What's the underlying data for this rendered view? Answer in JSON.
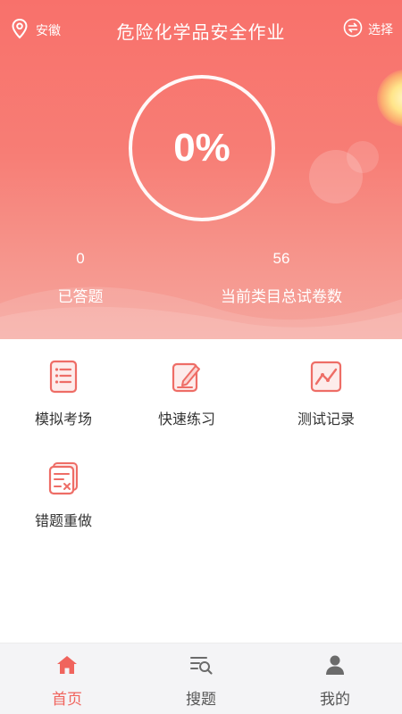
{
  "header": {
    "location": "安徽",
    "title": "危险化学品安全作业",
    "switch_label": "选择"
  },
  "progress": {
    "percent_text": "0%",
    "answered_count": "0",
    "answered_label": "已答题",
    "total_papers": "56",
    "total_papers_label": "当前类目总试卷数"
  },
  "actions": [
    {
      "label": "模拟考场",
      "icon": "exam-list-icon"
    },
    {
      "label": "快速练习",
      "icon": "edit-practice-icon"
    },
    {
      "label": "测试记录",
      "icon": "trend-chart-icon"
    },
    {
      "label": "错题重做",
      "icon": "wrong-question-icon"
    }
  ],
  "tabbar": {
    "items": [
      {
        "label": "首页",
        "icon": "home-icon",
        "active": true
      },
      {
        "label": "搜题",
        "icon": "search-list-icon",
        "active": false
      },
      {
        "label": "我的",
        "icon": "user-icon",
        "active": false
      }
    ]
  },
  "colors": {
    "accent": "#f0645d",
    "hero_top": "#f8716b",
    "hero_bottom": "#f5a59d",
    "icon": "#ee6d66",
    "text": "#333333",
    "tab_inactive": "#6b6b6b"
  }
}
